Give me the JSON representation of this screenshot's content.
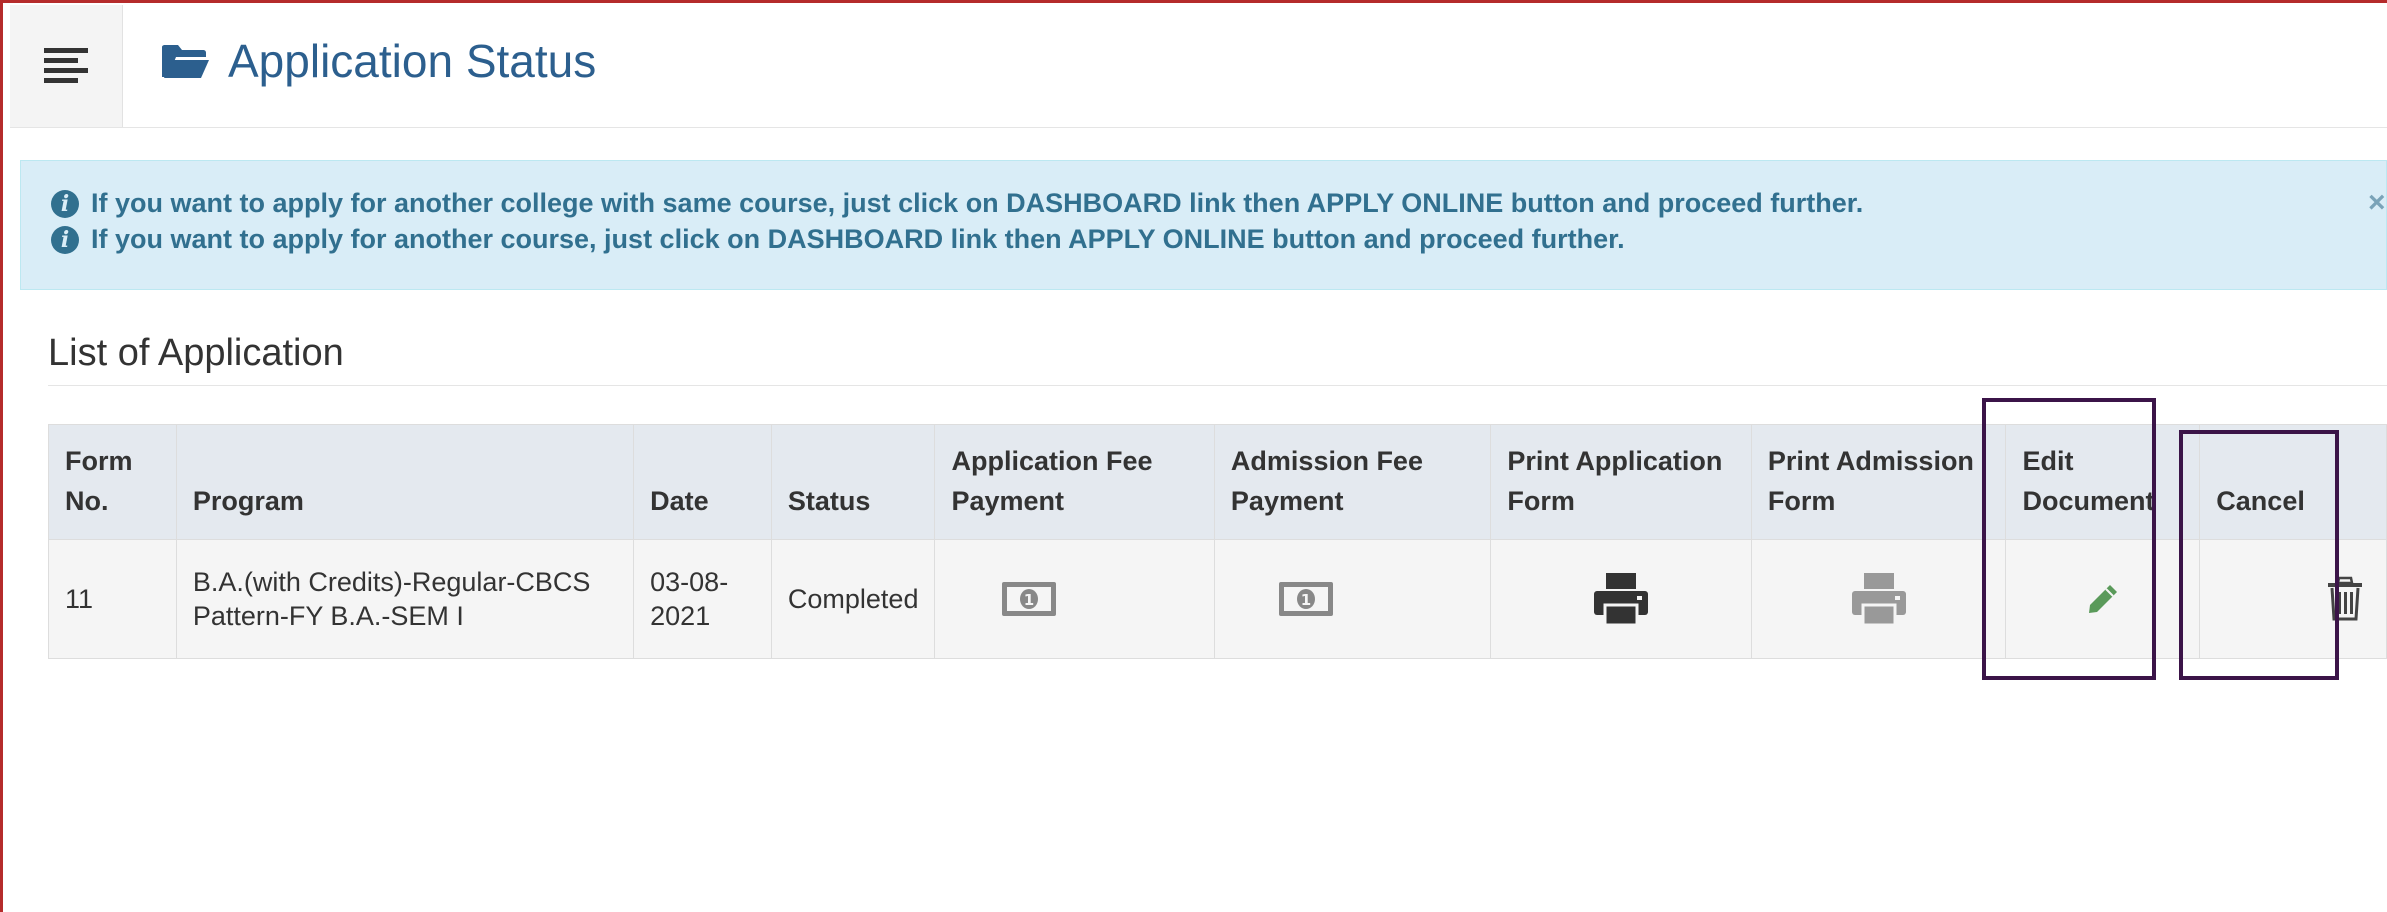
{
  "header": {
    "menu_icon": "hamburger-icon",
    "title_icon": "folder-open-icon",
    "title": "Application Status"
  },
  "alert": {
    "icon": "info-circle-icon",
    "lines": [
      "If you want to apply for another college with same course, just click on DASHBOARD link then APPLY ONLINE button and proceed further.",
      "If you want to apply for another course, just click on DASHBOARD link then APPLY ONLINE button and proceed further."
    ],
    "close": "×"
  },
  "section": {
    "title": "List of Application"
  },
  "table": {
    "headers": {
      "form_no": "Form No.",
      "program": "Program",
      "date": "Date",
      "status": "Status",
      "app_fee": "Application Fee Payment",
      "adm_fee": "Admission Fee Payment",
      "print_app": "Print Application Form",
      "print_adm": "Print Admission Form",
      "edit_doc": "Edit Document",
      "cancel": "Cancel"
    },
    "rows": [
      {
        "form_no": "11",
        "program": "B.A.(with Credits)-Regular-CBCS Pattern-FY B.A.-SEM I",
        "date": "03-08-2021",
        "status": "Completed",
        "app_fee_icon": "money-icon",
        "adm_fee_icon": "money-icon",
        "print_app_icon": "printer-icon",
        "print_adm_icon": "printer-icon",
        "edit_icon": "pencil-icon",
        "cancel_icon": "trash-icon"
      }
    ]
  },
  "colors": {
    "title": "#2c5f8e",
    "alert_bg": "#d9edf7",
    "alert_text": "#31708f",
    "table_header_bg": "#e4e9ef",
    "highlight_box": "#3b1448",
    "pencil": "#5a9a5a",
    "printer_dark": "#333333",
    "printer_light": "#999999"
  }
}
